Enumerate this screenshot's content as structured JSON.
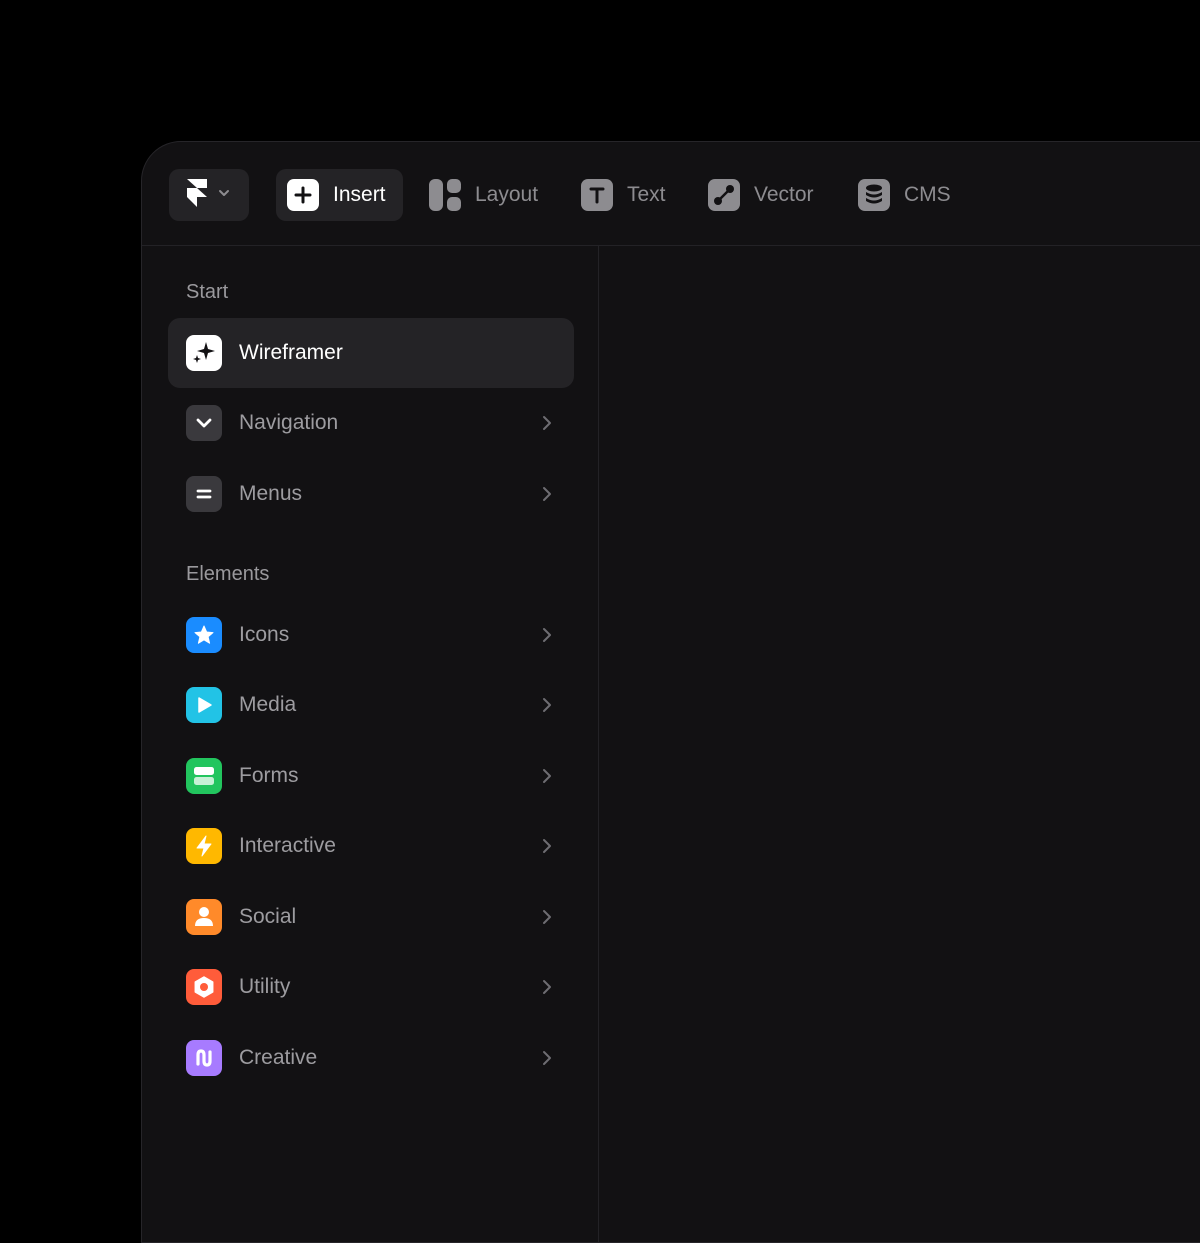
{
  "toolbar": {
    "tools": [
      {
        "label": "Insert",
        "icon": "plus-icon",
        "active": true
      },
      {
        "label": "Layout",
        "icon": "layout-icon"
      },
      {
        "label": "Text",
        "icon": "text-icon"
      },
      {
        "label": "Vector",
        "icon": "vector-icon"
      },
      {
        "label": "CMS",
        "icon": "database-icon"
      }
    ]
  },
  "sidebar": {
    "sections": [
      {
        "title": "Start",
        "items": [
          {
            "label": "Wireframer",
            "icon": "sparkles-icon",
            "active": true
          },
          {
            "label": "Navigation",
            "icon": "chevron-down-icon"
          },
          {
            "label": "Menus",
            "icon": "menu-lines-icon"
          }
        ]
      },
      {
        "title": "Elements",
        "items": [
          {
            "label": "Icons",
            "icon": "star-icon",
            "color": "#1a8cff"
          },
          {
            "label": "Media",
            "icon": "play-icon",
            "color": "#22c3e6"
          },
          {
            "label": "Forms",
            "icon": "form-icon",
            "color": "#22c55e"
          },
          {
            "label": "Interactive",
            "icon": "lightning-icon",
            "color": "#ffb800"
          },
          {
            "label": "Social",
            "icon": "user-icon",
            "color": "#ff8a2a"
          },
          {
            "label": "Utility",
            "icon": "hexagon-icon",
            "color": "#ff5c3a"
          },
          {
            "label": "Creative",
            "icon": "squiggle-icon",
            "color": "#a77bff"
          }
        ]
      }
    ]
  }
}
